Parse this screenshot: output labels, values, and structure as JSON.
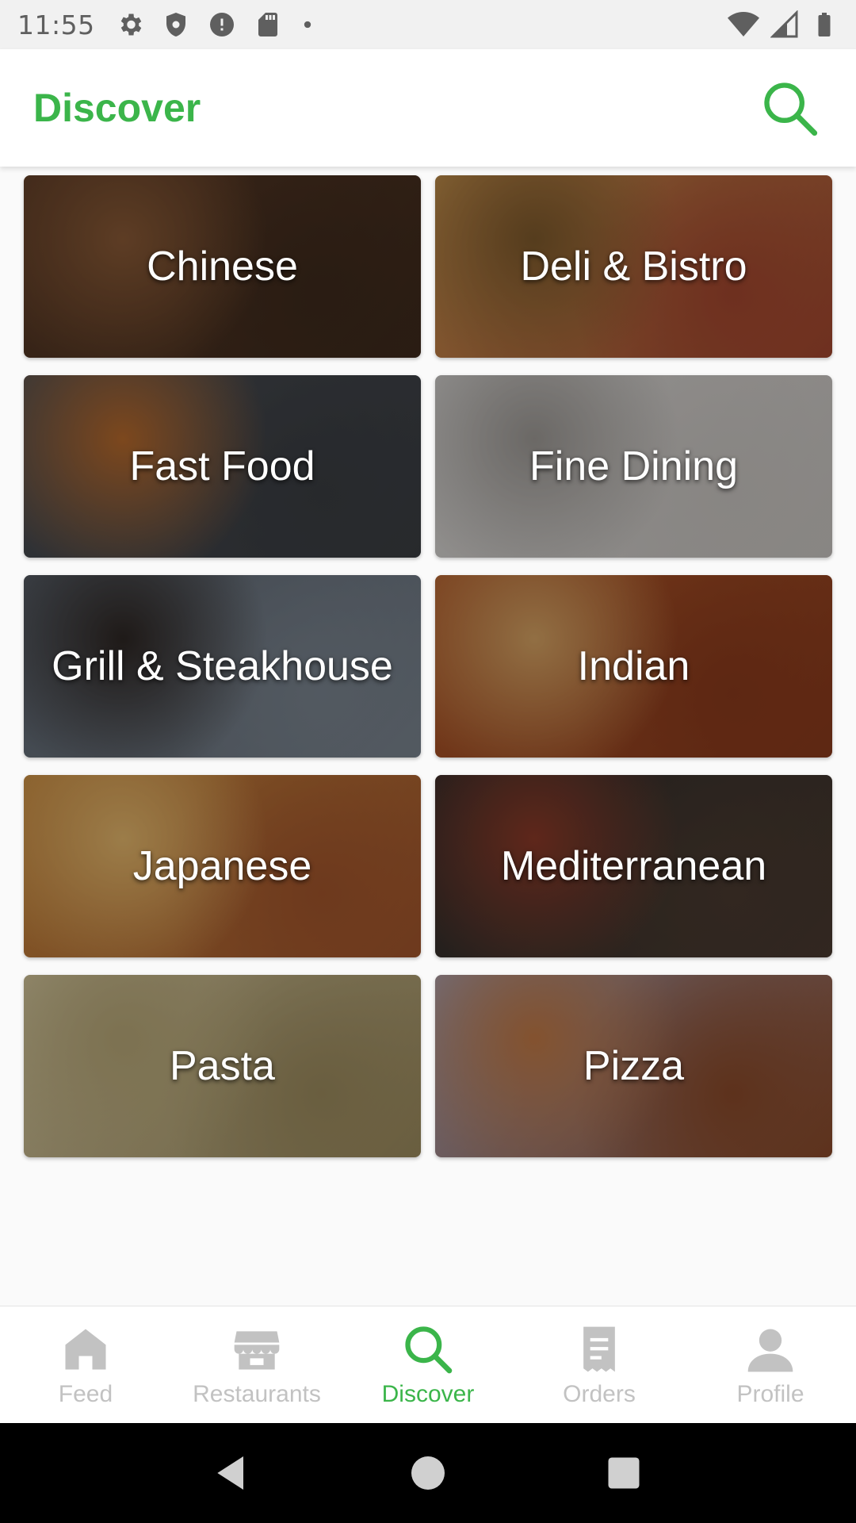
{
  "status_bar": {
    "time": "11:55",
    "icons": [
      "gear-icon",
      "shield-icon",
      "alert-icon",
      "sd-card-icon",
      "dot-icon",
      "wifi-icon",
      "signal-icon",
      "battery-icon"
    ]
  },
  "app_bar": {
    "title": "Discover",
    "search_icon": "search-icon"
  },
  "colors": {
    "accent": "#3bb54a",
    "inactive": "#c2c2c2",
    "status_bar_bg": "#f1f1f1"
  },
  "categories": [
    {
      "label": "Chinese",
      "colors": [
        "#5a3a26",
        "#8a5a36",
        "#3e2a1c"
      ]
    },
    {
      "label": "Deli & Bistro",
      "colors": [
        "#c9954f",
        "#7e5a2c",
        "#a3472f"
      ]
    },
    {
      "label": "Fast Food",
      "colors": [
        "#4b4f55",
        "#b86a2c",
        "#3a3d42"
      ]
    },
    {
      "label": "Fine Dining",
      "colors": [
        "#d8d6d4",
        "#9e9a96",
        "#c9c5c1"
      ]
    },
    {
      "label": "Grill & Steakhouse",
      "colors": [
        "#5c6570",
        "#2e2724",
        "#7a848f"
      ]
    },
    {
      "label": "Indian",
      "colors": [
        "#b25a2a",
        "#d7a464",
        "#8a3a1c"
      ]
    },
    {
      "label": "Japanese",
      "colors": [
        "#c98a3e",
        "#e6b86c",
        "#a2552c"
      ]
    },
    {
      "label": "Mediterranean",
      "colors": [
        "#2e2c2a",
        "#8c3a28",
        "#4a3a30"
      ]
    },
    {
      "label": "Pasta",
      "colors": [
        "#d6c9a0",
        "#b8a878",
        "#9c8b5e"
      ]
    },
    {
      "label": "Pizza",
      "colors": [
        "#a8a3b6",
        "#c27a46",
        "#8a4a2a"
      ]
    }
  ],
  "bottom_nav": {
    "items": [
      {
        "label": "Feed",
        "icon": "home-icon",
        "active": false
      },
      {
        "label": "Restaurants",
        "icon": "storefront-icon",
        "active": false
      },
      {
        "label": "Discover",
        "icon": "search-icon",
        "active": true
      },
      {
        "label": "Orders",
        "icon": "receipt-icon",
        "active": false
      },
      {
        "label": "Profile",
        "icon": "person-icon",
        "active": false
      }
    ]
  },
  "system_nav": [
    "back-icon",
    "home-circle-icon",
    "recents-icon"
  ]
}
